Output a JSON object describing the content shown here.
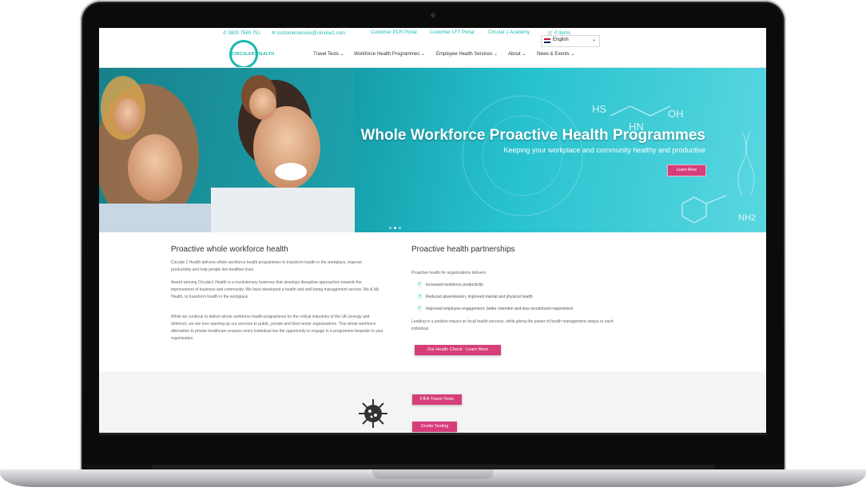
{
  "topbar": {
    "phone": "0800 7569 751",
    "email": "customerservice@circular1.com",
    "link1": "Customer PCR Portal",
    "link2": "Customer LFT Portal",
    "link3": "Circular 1 Academy",
    "cart": "0 Items"
  },
  "language": {
    "selected": "English"
  },
  "logo": {
    "text": "CIRCULAR1HEALTH"
  },
  "nav": {
    "items": [
      "Travel Tests",
      "Workforce Health Programmes",
      "Employee Health Services",
      "About",
      "News & Events"
    ]
  },
  "hero": {
    "title": "Whole Workforce Proactive Health Programmes",
    "subtitle": "Keeping your workplace and community healthy and productive",
    "button": "Learn More",
    "chem": {
      "hs": "HS",
      "oh": "OH",
      "hn": "HN",
      "nh2": "NH2"
    }
  },
  "left": {
    "heading": "Proactive whole workforce health",
    "p1": "Circular 1 Health delivers whole workforce health programmes to transform health in the workplace, improve productivity and help people live healthier lives.",
    "p2": "Award winning Circular1 Health is a revolutionary business that develops disruptive approaches towards the improvement of business and community. We have developed a health and well-being management service, Me & My Health, to transform health in the workplace.",
    "p3": "While we continue to deliver whole workforce health programmes for the critical industries of the UK (energy and defence), we are now opening up our services to public, private and third sector organisations. This whole workforce alternative to private healthcare ensures every individual has the opportunity to engage in a programme bespoke to your organisation."
  },
  "right": {
    "heading": "Proactive health partnerships",
    "intro": "Proactive health for organisations delivers:",
    "checks": [
      "Increased workforce productivity",
      "Reduced absenteeism, improved mental and physical health",
      "Improved employee engagement, better retention and less recruitment requirement"
    ],
    "outro": "Leading to a positive impact on local health services, while giving the power of health management unique to each individual.",
    "button": "Our Health Check - Learn More"
  },
  "lower": {
    "button1": "FIFA Travel Tests",
    "button2": "Onsite Testing"
  },
  "colors": {
    "accent": "#19b8b0",
    "pink": "#d63e79"
  }
}
